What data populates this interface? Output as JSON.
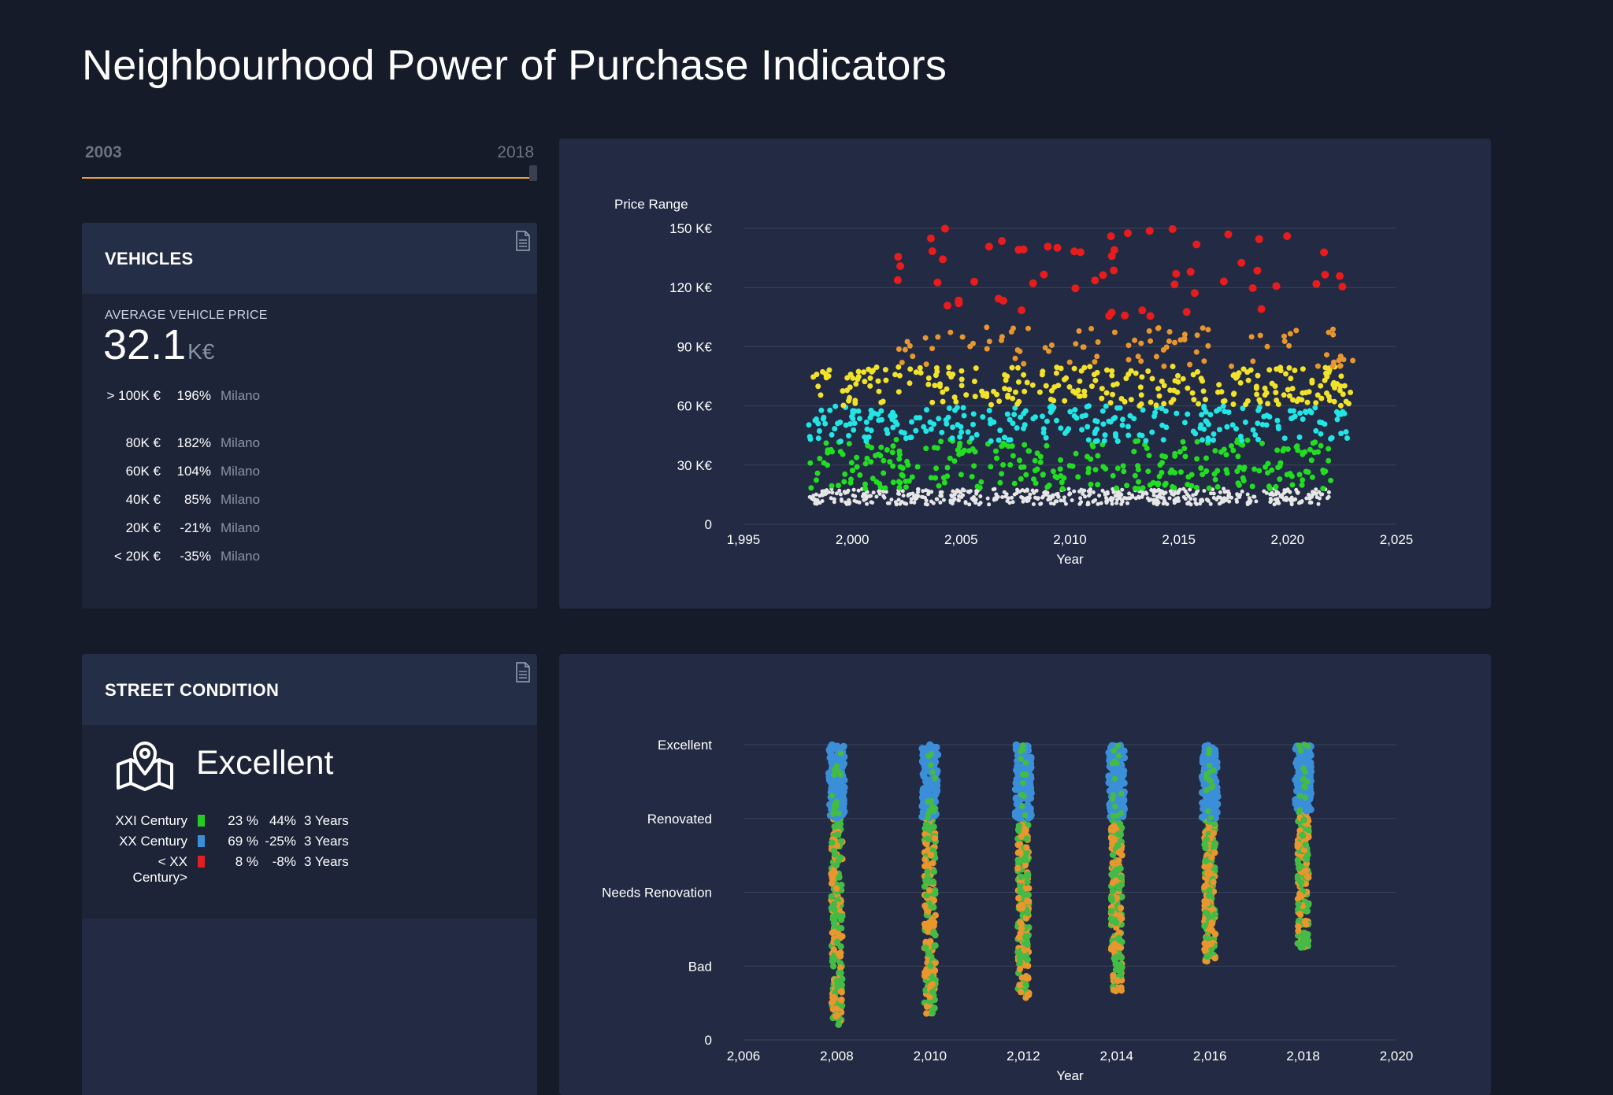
{
  "page": {
    "title": "Neighbourhood Power of Purchase Indicators"
  },
  "year_range": {
    "min_label": "2003",
    "max_label": "2018"
  },
  "vehicles": {
    "title": "VEHICLES",
    "icon": "document-icon",
    "kpi_label": "AVERAGE VEHICLE PRICE",
    "kpi_value": "32.1",
    "kpi_unit": "K€",
    "rows": [
      {
        "range": "> 100K €",
        "pct": "196%",
        "city": "Milano"
      },
      {
        "range": "80K €",
        "pct": "182%",
        "city": "Milano"
      },
      {
        "range": "60K €",
        "pct": "104%",
        "city": "Milano"
      },
      {
        "range": "40K €",
        "pct": "85%",
        "city": "Milano"
      },
      {
        "range": "20K €",
        "pct": "-21%",
        "city": "Milano"
      },
      {
        "range": "< 20K €",
        "pct": "-35%",
        "city": "Milano"
      }
    ]
  },
  "street": {
    "title": "STREET CONDITION",
    "icon": "map-pin-icon",
    "condition": "Excellent",
    "rows": [
      {
        "era": "XXI Century",
        "color": "#22cc22",
        "share": "23 %",
        "change": "44%",
        "period": "3 Years"
      },
      {
        "era": "XX Century",
        "color": "#3b8fd9",
        "share": "69 %",
        "change": "-25%",
        "period": "3 Years"
      },
      {
        "era": "< XX Century>",
        "color": "#e02020",
        "share": "8 %",
        "change": "-8%",
        "period": "3 Years"
      }
    ]
  },
  "chart_data": [
    {
      "type": "scatter",
      "title": "",
      "ylabel": "Price Range",
      "xlabel": "Year",
      "xlim": [
        1995,
        2025
      ],
      "ylim": [
        0,
        150
      ],
      "x_ticks": [
        "1,995",
        "2,000",
        "2,005",
        "2,010",
        "2,015",
        "2,020",
        "2,025"
      ],
      "y_ticks": [
        "0",
        "30 K€",
        "60 K€",
        "90 K€",
        "120 K€",
        "150 K€"
      ],
      "grid": true,
      "legend": "none",
      "series": [
        {
          "color": "#e6e6e6",
          "x_range": [
            1998,
            2022
          ],
          "y_range": [
            10,
            18
          ],
          "count": 520
        },
        {
          "color": "#22dd22",
          "x_range": [
            1998,
            2022
          ],
          "y_range": [
            18,
            43
          ],
          "count": 300
        },
        {
          "color": "#22e5e5",
          "x_range": [
            1998,
            2023
          ],
          "y_range": [
            42,
            60
          ],
          "count": 260
        },
        {
          "color": "#f2e22a",
          "x_range": [
            1998,
            2023
          ],
          "y_range": [
            60,
            80
          ],
          "count": 270
        },
        {
          "color": "#e8962e",
          "x_range": [
            2002,
            2023
          ],
          "y_range": [
            80,
            100
          ],
          "count": 90
        },
        {
          "color": "#e81c1c",
          "x_range": [
            2000,
            2023
          ],
          "y_range": [
            105,
            150
          ],
          "count": 60
        }
      ]
    },
    {
      "type": "scatter",
      "title": "",
      "xlabel": "Year",
      "xlim": [
        2006,
        2020
      ],
      "ylim": [
        0,
        4
      ],
      "x_ticks": [
        "2,006",
        "2,008",
        "2,010",
        "2,012",
        "2,014",
        "2,016",
        "2,018",
        "2,020"
      ],
      "y_ticks": [
        "0",
        "Bad",
        "Needs Renovation",
        "Renovated",
        "Excellent"
      ],
      "grid": true,
      "legend": "none",
      "columns": [
        {
          "x": 2008,
          "blue_min": 3.0,
          "mixed_min": 0.2
        },
        {
          "x": 2010,
          "blue_min": 3.0,
          "mixed_min": 0.35
        },
        {
          "x": 2012,
          "blue_min": 3.0,
          "mixed_min": 0.55
        },
        {
          "x": 2014,
          "blue_min": 3.0,
          "mixed_min": 0.65
        },
        {
          "x": 2016,
          "blue_min": 3.0,
          "mixed_min": 1.05
        },
        {
          "x": 2018,
          "blue_min": 3.1,
          "mixed_min": 1.25
        }
      ],
      "series_colors": [
        "#3b8fd9",
        "#e8962e",
        "#44bb44"
      ]
    }
  ]
}
